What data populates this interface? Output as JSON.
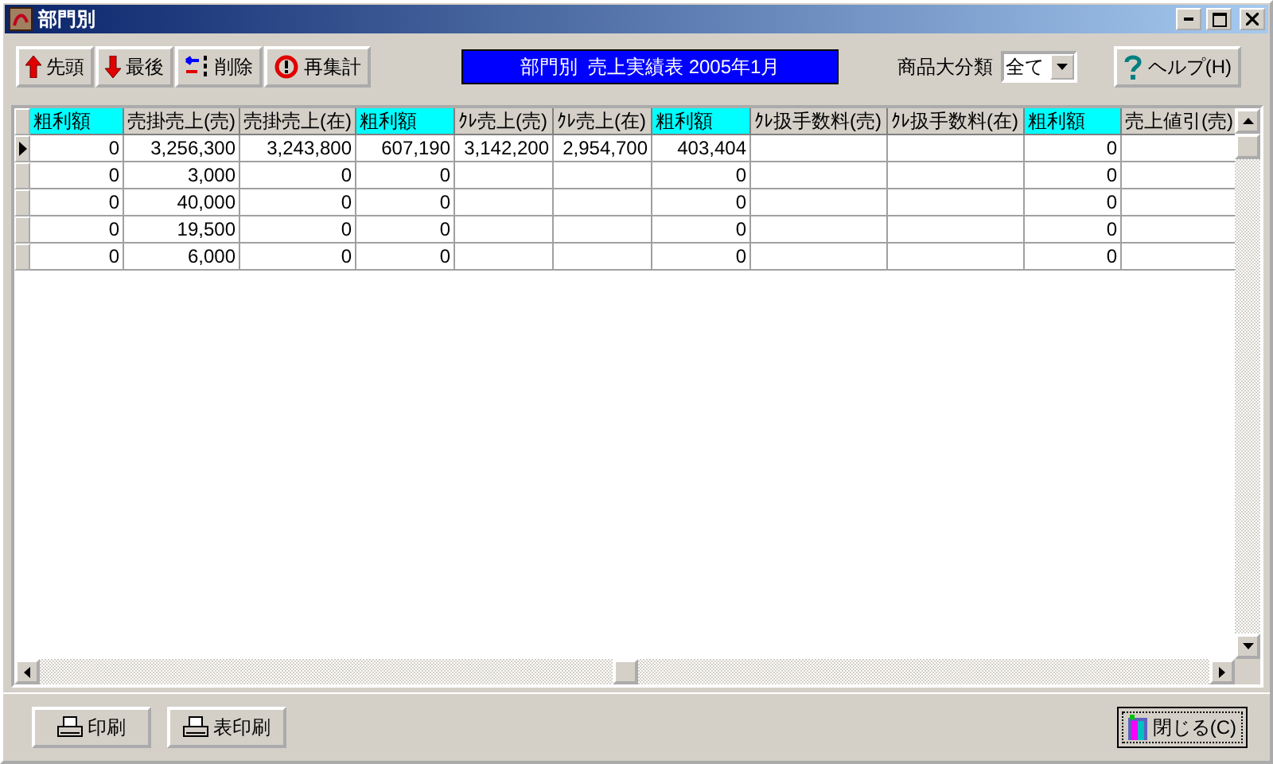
{
  "window": {
    "title": "部門別"
  },
  "toolbar": {
    "buttons": [
      {
        "kind": "first",
        "label": "先頭"
      },
      {
        "kind": "last",
        "label": "最後"
      },
      {
        "kind": "delete",
        "label": "削除"
      },
      {
        "kind": "recalc",
        "label": "再集計"
      }
    ],
    "report_title": "部門別  売上実績表 2005年1月",
    "category": {
      "label": "商品大分類",
      "value": "全て"
    },
    "help_button": "ヘルプ(H)"
  },
  "table": {
    "columns": [
      {
        "label": "粗利額",
        "highlighted": true
      },
      {
        "label": "売掛売上(売)",
        "highlighted": false
      },
      {
        "label": "売掛売上(在)",
        "highlighted": false
      },
      {
        "label": "粗利額",
        "highlighted": true
      },
      {
        "label": "ｸﾚ売上(売)",
        "highlighted": false
      },
      {
        "label": "ｸﾚ売上(在)",
        "highlighted": false
      },
      {
        "label": "粗利額",
        "highlighted": true
      },
      {
        "label": "ｸﾚ扱手数料(売)",
        "highlighted": false
      },
      {
        "label": "ｸﾚ扱手数料(在)",
        "highlighted": false
      },
      {
        "label": "粗利額",
        "highlighted": true
      },
      {
        "label": "売上値引(売)",
        "highlighted": false
      }
    ],
    "rows": [
      {
        "current": true,
        "cells": [
          "0",
          "3,256,300",
          "3,243,800",
          "607,190",
          "3,142,200",
          "2,954,700",
          "403,404",
          null,
          null,
          "0",
          null
        ]
      },
      {
        "current": false,
        "cells": [
          "0",
          "3,000",
          "0",
          "0",
          null,
          null,
          "0",
          null,
          null,
          "0",
          null
        ]
      },
      {
        "current": false,
        "cells": [
          "0",
          "40,000",
          "0",
          "0",
          null,
          null,
          "0",
          null,
          null,
          "0",
          null
        ]
      },
      {
        "current": false,
        "cells": [
          "0",
          "19,500",
          "0",
          "0",
          null,
          null,
          "0",
          null,
          null,
          "0",
          null
        ]
      },
      {
        "current": false,
        "cells": [
          "0",
          "6,000",
          "0",
          "0",
          null,
          null,
          "0",
          null,
          null,
          "0",
          null
        ]
      }
    ]
  },
  "footer": {
    "print_buttons": [
      "印刷",
      "表印刷"
    ],
    "close_button": "閉じる(C)"
  }
}
